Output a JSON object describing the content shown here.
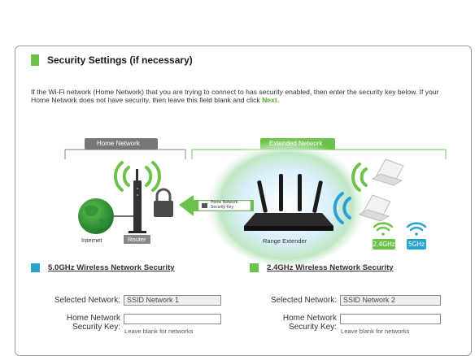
{
  "header": {
    "title": "Security Settings (if necessary)"
  },
  "intro": {
    "text": "If the Wi-Fi network (Home Network) that you are trying to connect to has security enabled, then enter the security key below. If your Home Network does not have security, then leave this field blank and click",
    "link": "Next",
    "end": "."
  },
  "diagram": {
    "home_network_label": "Home Network",
    "extended_network_label": "Extended Network",
    "internet_label": "Internet",
    "router_label": "Router",
    "range_extender_label": "Range Extender",
    "key_card_line1": "Home Network",
    "key_card_line2": "Security Key",
    "band_24": "2.4GHz",
    "band_5": "5GHz",
    "colors": {
      "green": "#6cc24a",
      "blue": "#2aa3cf",
      "grey_tab": "#777777"
    }
  },
  "net5": {
    "title": "5.0GHz Wireless Network Security",
    "selected_label": "Selected Network:",
    "selected_value": "SSID Network 1",
    "key_label_1": "Home Network",
    "key_label_2": "Security Key:",
    "key_value": "",
    "hint": "Leave blank for networks"
  },
  "net24": {
    "title": "2.4GHz Wireless Network Security",
    "selected_label": "Selected Network:",
    "selected_value": "SSID Network 2",
    "key_label_1": "Home Network",
    "key_label_2": "Security Key:",
    "key_value": "",
    "hint": "Leave blank for networks"
  }
}
